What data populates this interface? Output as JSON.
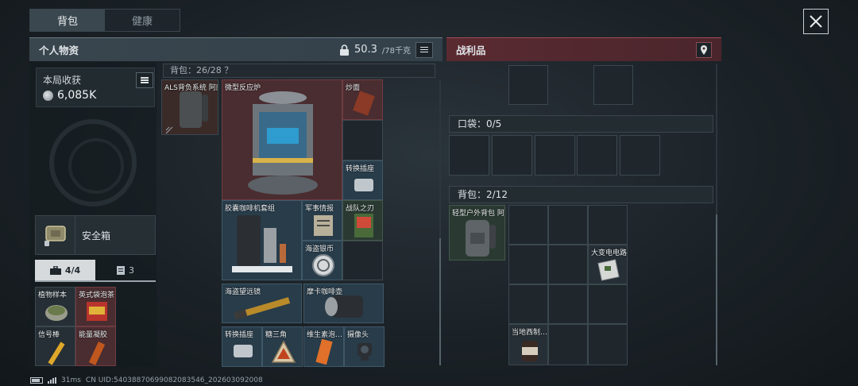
{
  "tabs": [
    {
      "label": "背包",
      "active": true
    },
    {
      "label": "健康",
      "active": false
    }
  ],
  "personal": {
    "title": "个人物资",
    "weight_current": "50.3",
    "weight_max": "/78千克"
  },
  "loot": {
    "title": "战利品"
  },
  "harvest": {
    "title": "本局收获",
    "value": "6,085K"
  },
  "safebox": {
    "label": "安全箱"
  },
  "subtabs": [
    {
      "label": "4/4",
      "icon": "toolbox-icon",
      "active": true
    },
    {
      "label": "3",
      "icon": "clipboard-icon",
      "active": false
    }
  ],
  "safebox_items": [
    {
      "name": "植物样本"
    },
    {
      "name": "英式袋泡茶"
    },
    {
      "name": "信号棒"
    },
    {
      "name": "能量凝胶"
    }
  ],
  "backpack": {
    "header": "背包：26/28 ？",
    "items": [
      {
        "name": "ALS背负系统 阿萨拉…"
      },
      {
        "name": "微型反应炉"
      },
      {
        "name": "炒面"
      },
      {
        "name": "转换插座"
      },
      {
        "name": "胶囊咖啡机套组"
      },
      {
        "name": "军事情报"
      },
      {
        "name": "战队之刃"
      },
      {
        "name": "海盗银币"
      },
      {
        "name": "海盗望远镜"
      },
      {
        "name": "摩卡咖啡壶"
      },
      {
        "name": "转换插座"
      },
      {
        "name": "糖三角"
      },
      {
        "name": "维生素泡…"
      },
      {
        "name": "摄像头"
      }
    ]
  },
  "loot_pockets": {
    "header": "口袋：0/5"
  },
  "loot_backpack": {
    "header": "背包：2/12",
    "bag_name": "轻型户外背包 阿萨拉…",
    "items": [
      {
        "name": "大变电电路"
      },
      {
        "name": "当地西制…"
      }
    ]
  },
  "status": {
    "latency": "31ms",
    "uid": "CN UID:54038870699082083546_202603092008"
  }
}
